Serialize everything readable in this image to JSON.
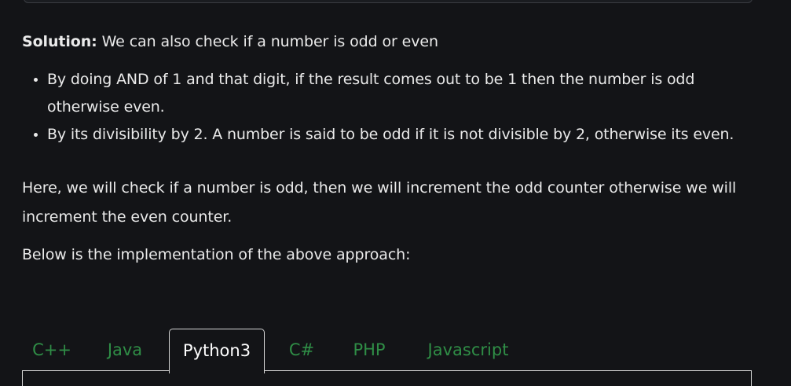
{
  "article": {
    "solution_label": "Solution:",
    "solution_text": " We can also check if a number is odd or even",
    "points": [
      "By doing AND of 1 and that digit, if the result comes out to be 1 then the number is odd otherwise even.",
      "By its divisibility by 2. A number is said to be odd if it is not divisible by 2, otherwise its even."
    ],
    "paragraph": "Here, we will check if a number is odd, then we will increment the odd counter otherwise we will increment the even counter.",
    "below": "Below is the implementation of the above approach:"
  },
  "tabs": [
    {
      "label": "C++"
    },
    {
      "label": "Java"
    },
    {
      "label": "Python3"
    },
    {
      "label": "C#"
    },
    {
      "label": "PHP"
    },
    {
      "label": "Javascript"
    }
  ],
  "active_tab": "Python3",
  "colors": {
    "background": "#131417",
    "text": "#eaeaea",
    "tab_link": "#2f8d46",
    "tab_border": "#d6d6d6"
  }
}
